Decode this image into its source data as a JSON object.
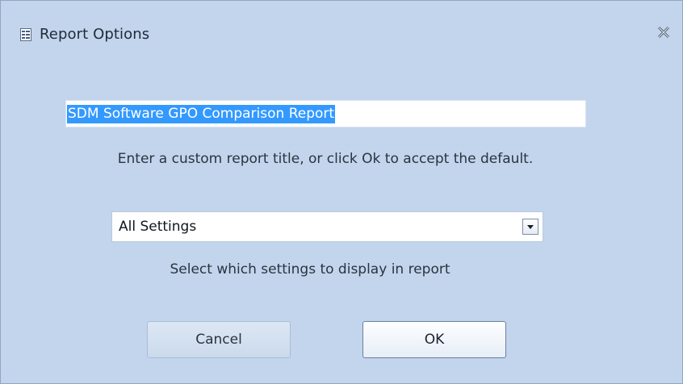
{
  "window": {
    "title": "Report Options",
    "title_icon": "report-icon",
    "close_icon": "close-icon"
  },
  "report_title": {
    "value": "SDM Software GPO Comparison Report",
    "hint": "Enter a custom report title, or click Ok to accept the default."
  },
  "settings_select": {
    "selected": "All Settings",
    "hint": "Select which settings to display in report"
  },
  "buttons": {
    "cancel_label": "Cancel",
    "ok_label": "OK"
  },
  "colors": {
    "background": "#c2d5ec",
    "selection": "#3399ff"
  }
}
